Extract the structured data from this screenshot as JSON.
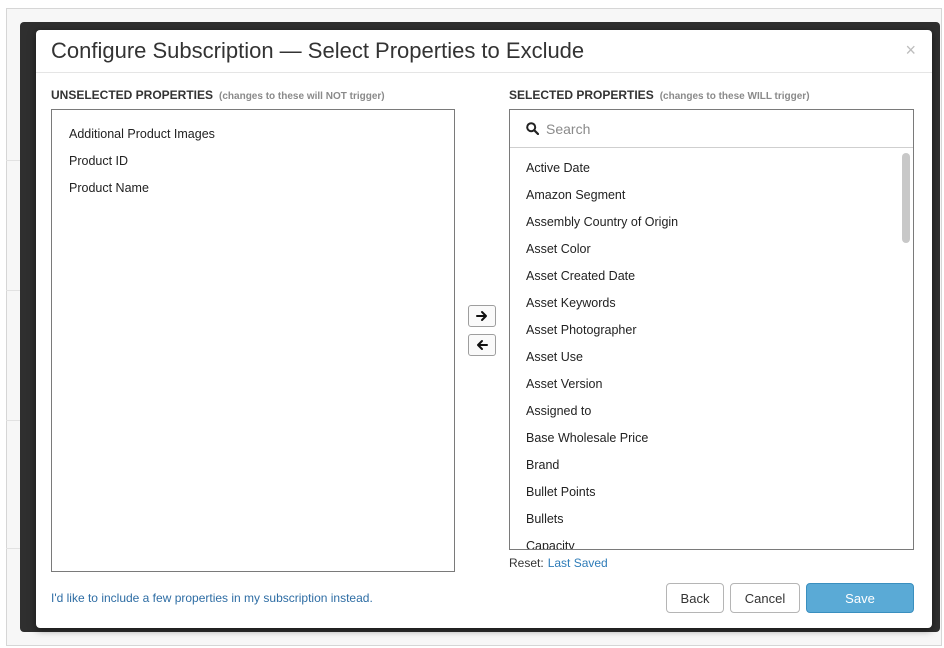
{
  "modal": {
    "title": "Configure Subscription — Select Properties to Exclude",
    "close_label": "×"
  },
  "unselected": {
    "heading": "UNSELECTED PROPERTIES",
    "hint": "(changes to these will NOT trigger)",
    "items": [
      "Additional Product Images",
      "Product ID",
      "Product Name"
    ]
  },
  "selected": {
    "heading": "SELECTED PROPERTIES",
    "hint": "(changes to these WILL trigger)",
    "search_placeholder": "Search",
    "items": [
      "Active Date",
      "Amazon Segment",
      "Assembly Country of Origin",
      "Asset Color",
      "Asset Created Date",
      "Asset Keywords",
      "Asset Photographer",
      "Asset Use",
      "Asset Version",
      "Assigned to",
      "Base Wholesale Price",
      "Brand",
      "Bullet Points",
      "Bullets",
      "Capacity"
    ]
  },
  "transfer": {
    "move_right_icon": "arrow-right-icon",
    "move_left_icon": "arrow-left-icon"
  },
  "reset": {
    "label": "Reset:",
    "link": "Last Saved"
  },
  "footer": {
    "include_link": "I'd like to include a few properties in my subscription instead.",
    "back": "Back",
    "cancel": "Cancel",
    "save": "Save"
  },
  "colors": {
    "link": "#2e6da4",
    "primary_button": "#5aaad6",
    "overlay": "#2f2f2f"
  }
}
